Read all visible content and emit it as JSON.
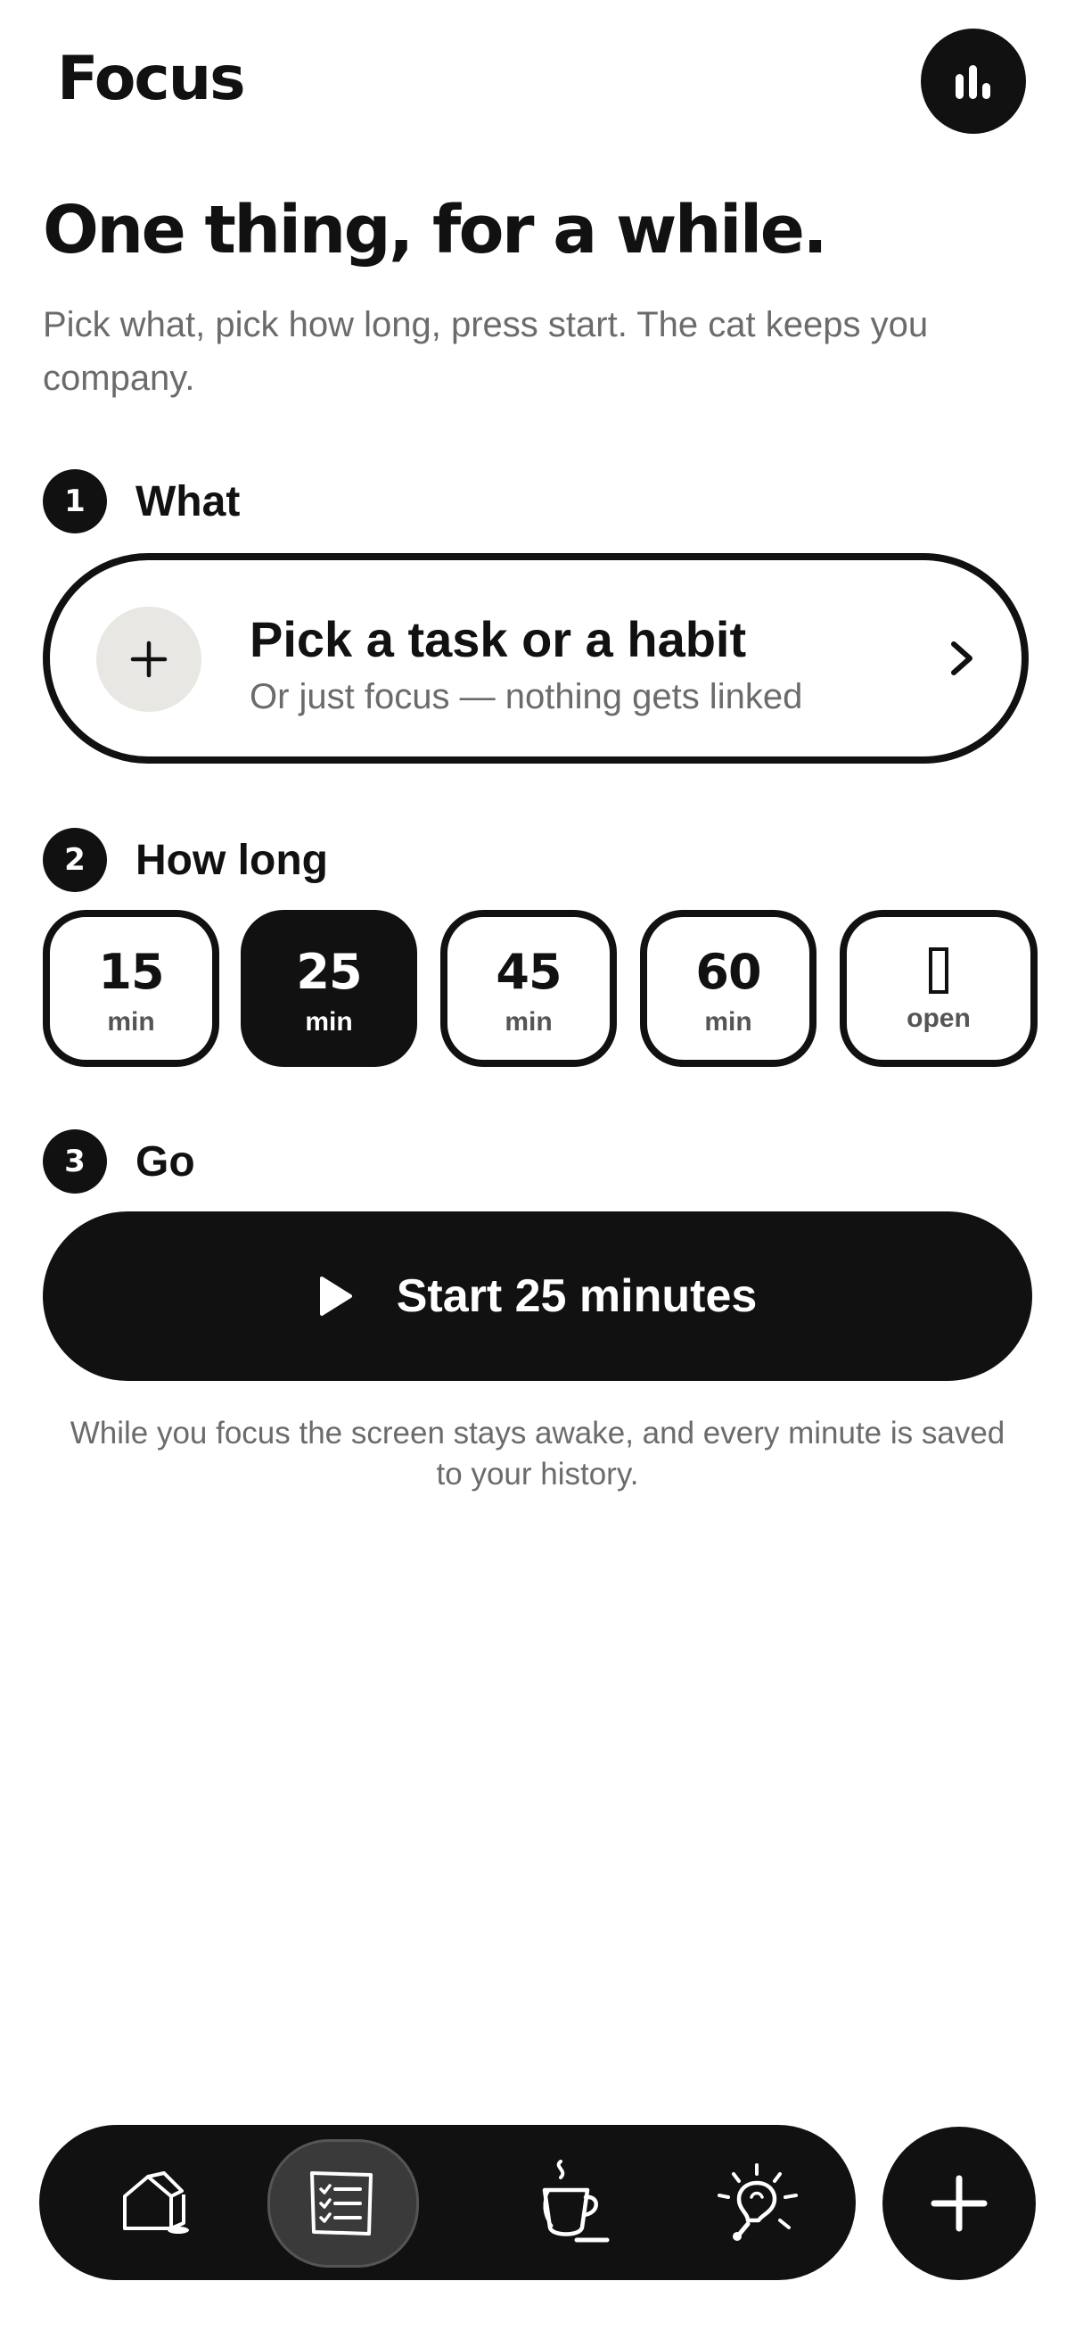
{
  "header": {
    "title": "Focus",
    "stats_icon": "bar-chart-icon"
  },
  "intro": {
    "headline": "One thing, for a while.",
    "subtitle": "Pick what, pick how long, press start. The cat keeps you company."
  },
  "steps": [
    {
      "number": "1",
      "label": "What"
    },
    {
      "number": "2",
      "label": "How long"
    },
    {
      "number": "3",
      "label": "Go"
    }
  ],
  "picker": {
    "title": "Pick a task or a habit",
    "subtitle": "Or just focus — nothing gets linked",
    "icon": "plus-icon",
    "chevron": "chevron-right-icon"
  },
  "durations": [
    {
      "value": "15",
      "unit": "min",
      "selected": false
    },
    {
      "value": "25",
      "unit": "min",
      "selected": true
    },
    {
      "value": "45",
      "unit": "min",
      "selected": false
    },
    {
      "value": "60",
      "unit": "min",
      "selected": false
    },
    {
      "value": "",
      "unit": "open",
      "selected": false
    }
  ],
  "start": {
    "label": "Start 25 minutes",
    "icon": "play-icon"
  },
  "note": "While you focus the screen stays awake, and every minute is saved to your history.",
  "nav": {
    "items": [
      {
        "name": "home",
        "icon": "house-icon",
        "active": false
      },
      {
        "name": "list",
        "icon": "checklist-icon",
        "active": true
      },
      {
        "name": "focus",
        "icon": "coffee-cup-icon",
        "active": false
      },
      {
        "name": "ideas",
        "icon": "lightbulb-icon",
        "active": false
      }
    ],
    "fab_icon": "plus-icon"
  },
  "colors": {
    "ink": "#111111",
    "muted": "#6b6b6b",
    "chip": "#e8e7e3",
    "background": "#ffffff"
  }
}
